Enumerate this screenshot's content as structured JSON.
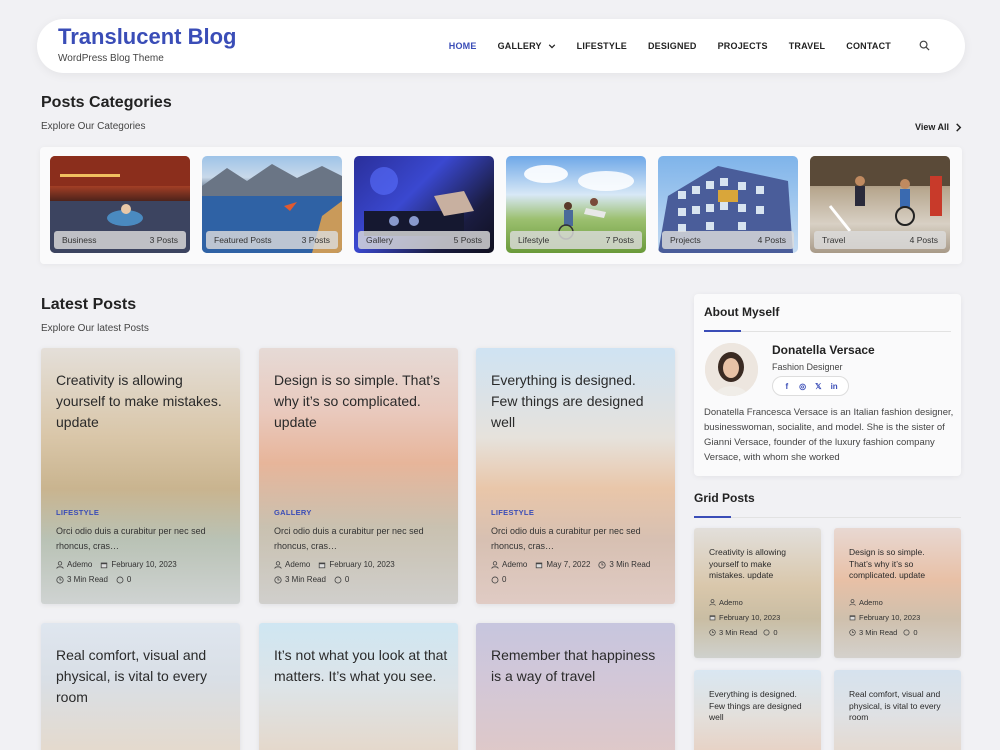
{
  "header": {
    "title": "Translucent Blog",
    "tagline": "WordPress Blog Theme",
    "nav": [
      "HOME",
      "GALLERY",
      "LIFESTYLE",
      "DESIGNED",
      "PROJECTS",
      "TRAVEL",
      "CONTACT"
    ],
    "active": "HOME"
  },
  "categories": {
    "title": "Posts Categories",
    "subtitle": "Explore Our Categories",
    "view_all": "View All",
    "items": [
      {
        "name": "Business",
        "count": "3 Posts"
      },
      {
        "name": "Featured Posts",
        "count": "3 Posts"
      },
      {
        "name": "Gallery",
        "count": "5 Posts"
      },
      {
        "name": "Lifestyle",
        "count": "7 Posts"
      },
      {
        "name": "Projects",
        "count": "4 Posts"
      },
      {
        "name": "Travel",
        "count": "4 Posts"
      }
    ]
  },
  "latest": {
    "title": "Latest Posts",
    "subtitle": "Explore Our latest Posts",
    "posts": [
      {
        "title": "Creativity is allowing yourself to make mistakes. update",
        "category": "LIFESTYLE",
        "excerpt": "Orci odio duis a curabitur per nec sed rhoncus, cras…",
        "author": "Ademo",
        "date": "February 10, 2023",
        "read": "3 Min Read",
        "comments": "0"
      },
      {
        "title": "Design is so simple. That’s why it’s so complicated. update",
        "category": "GALLERY",
        "excerpt": "Orci odio duis a curabitur per nec sed rhoncus, cras…",
        "author": "Ademo",
        "date": "February 10, 2023",
        "read": "3 Min Read",
        "comments": "0"
      },
      {
        "title": "Everything is designed. Few things are designed well",
        "category": "LIFESTYLE",
        "excerpt": "Orci odio duis a curabitur per nec sed rhoncus, cras…",
        "author": "Ademo",
        "date": "May 7, 2022",
        "read": "3 Min Read",
        "comments": "0"
      },
      {
        "title": "Real comfort, visual and physical, is vital to every room"
      },
      {
        "title": "It’s not what you look at that matters. It’s what you see."
      },
      {
        "title": "Remember that happiness is a way of travel"
      }
    ]
  },
  "about": {
    "title": "About Myself",
    "name": "Donatella Versace",
    "role": "Fashion Designer",
    "bio": "Donatella Francesca Versace is an Italian fashion designer, businesswoman, socialite, and model. She is the sister of Gianni Versace, founder of the luxury fashion company Versace, with whom she worked",
    "social": [
      "f",
      "◎",
      "𝕏",
      "in"
    ]
  },
  "grid": {
    "title": "Grid Posts",
    "posts": [
      {
        "title": "Creativity is allowing yourself to make mistakes. update",
        "author": "Ademo",
        "date": "February 10, 2023",
        "read": "3 Min Read",
        "comments": "0"
      },
      {
        "title": "Design is so simple. That’s why it’s so complicated. update",
        "author": "Ademo",
        "date": "February 10, 2023",
        "read": "3 Min Read",
        "comments": "0"
      },
      {
        "title": "Everything is designed. Few things are designed well"
      },
      {
        "title": "Real comfort, visual and physical, is vital to every room"
      }
    ]
  },
  "colors": {
    "accent": "#3a4db7",
    "background": "#f1f1f4"
  }
}
